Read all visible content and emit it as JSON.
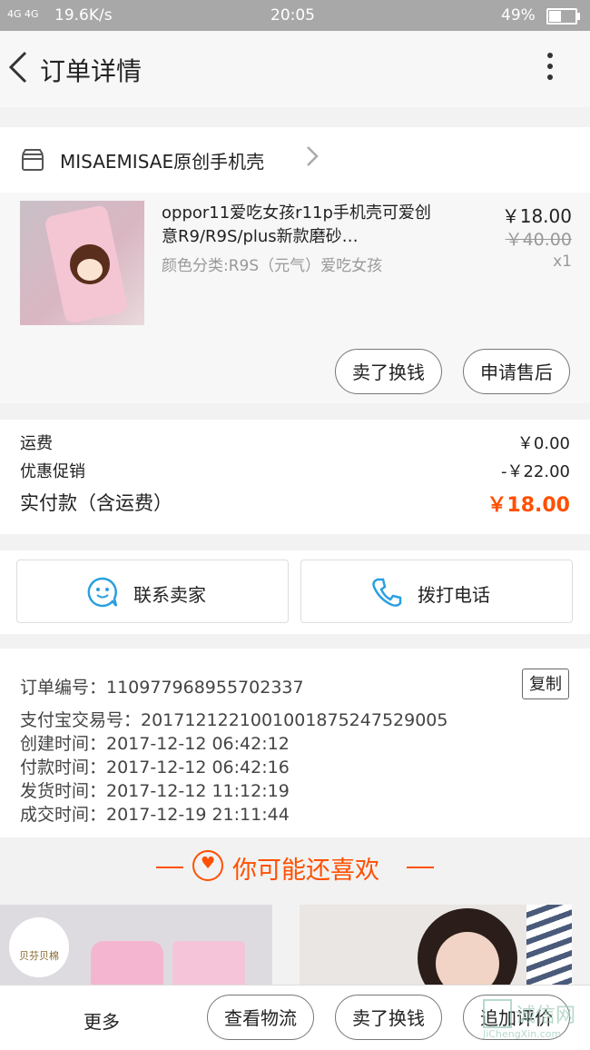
{
  "status_bar": {
    "signal": "4G 4G",
    "speed": "19.6K/s",
    "time": "20:05",
    "battery": "49%"
  },
  "header": {
    "title": "订单详情"
  },
  "shop": {
    "name": "MISAEMISAE原创手机壳"
  },
  "product": {
    "title": "oppor11爱吃女孩r11p手机壳可爱创意R9/R9S/plus新款磨砂…",
    "spec": "颜色分类:R9S（元气）爱吃女孩",
    "price": "￥18.00",
    "original_price": "￥40.00",
    "quantity": "x1",
    "actions": [
      "卖了换钱",
      "申请售后"
    ]
  },
  "fees": {
    "shipping_label": "运费",
    "shipping_value": "￥0.00",
    "discount_label": "优惠促销",
    "discount_value": "-￥22.00",
    "total_label": "实付款（含运费）",
    "total_value": "￥18.00"
  },
  "contact": {
    "chat_label": "联系卖家",
    "call_label": "拨打电话"
  },
  "order_info": {
    "order_no": "订单编号：110977968955702337",
    "alipay_no": "支付宝交易号：2017121221001001875247529005",
    "created": "创建时间：2017-12-12 06:42:12",
    "paid": "付款时间：2017-12-12 06:42:16",
    "shipped": "发货时间：2017-12-12 11:12:19",
    "completed": "成交时间：2017-12-19 21:11:44",
    "copy_label": "复制"
  },
  "recommend": {
    "title": "你可能还喜欢",
    "brand": "贝芬贝棉"
  },
  "bottom_bar": {
    "more_label": "更多",
    "buttons": [
      "查看物流",
      "卖了换钱",
      "追加评价"
    ]
  },
  "watermark": {
    "text": "诚信网",
    "url_text": "JiChengXin.com"
  },
  "colors": {
    "accent": "#ff5000",
    "chat_icon": "#2a9fe0"
  }
}
